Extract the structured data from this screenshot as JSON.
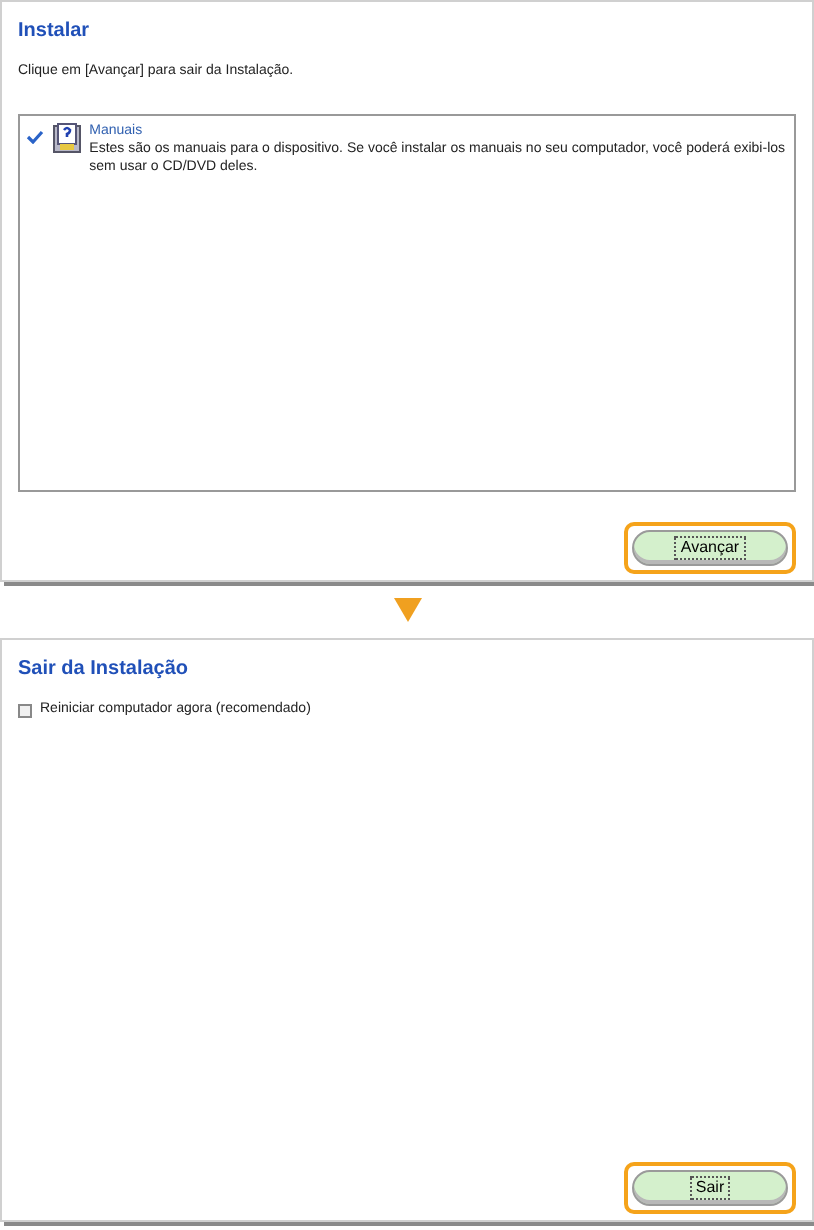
{
  "panels": [
    {
      "title": "Instalar",
      "instruction": "Clique em [Avançar] para sair da Instalação.",
      "items": [
        {
          "checked": true,
          "name": "Manuais",
          "description": "Estes são os manuais para o dispositivo. Se você instalar os manuais no seu computador, você poderá exibi-los sem usar o CD/DVD deles."
        }
      ],
      "button": {
        "label": "Avançar",
        "highlighted": true
      }
    },
    {
      "title": "Sair da Instalação",
      "option": {
        "label": "Reiniciar computador agora (recomendado)",
        "checked": false
      },
      "button": {
        "label": "Sair",
        "highlighted": true
      }
    }
  ]
}
